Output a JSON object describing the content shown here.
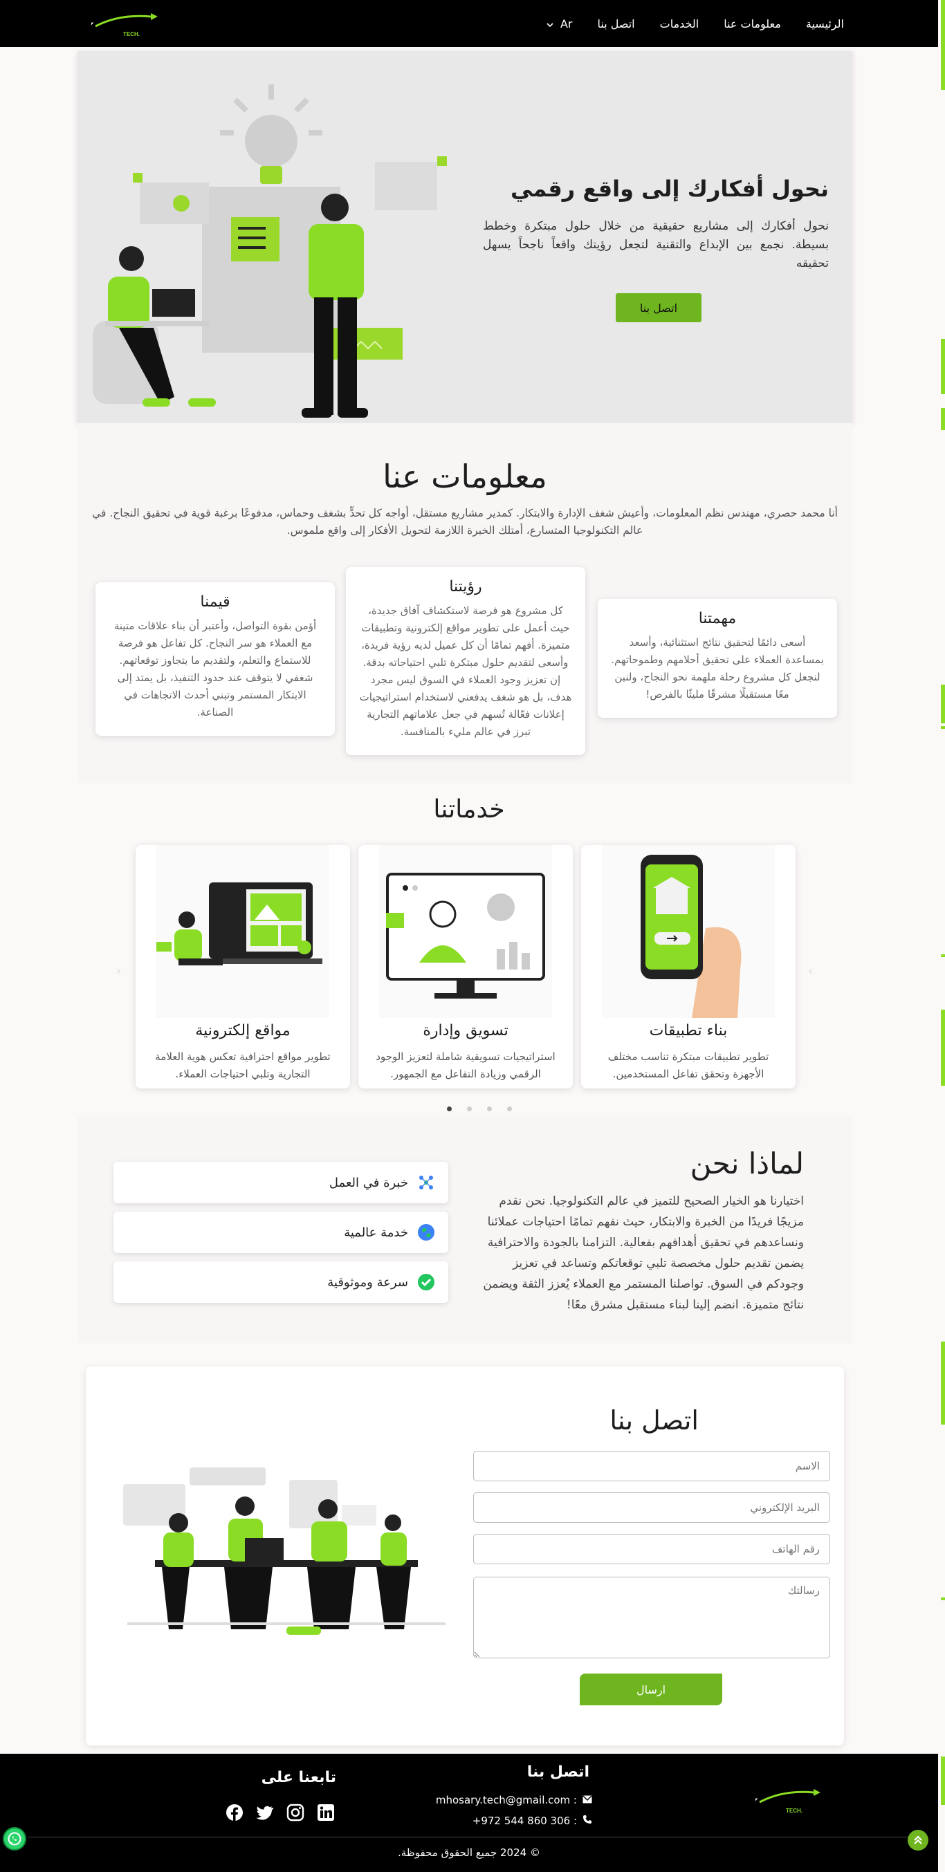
{
  "nav": {
    "links": [
      "الرئيسية",
      "معلومات عنا",
      "الخدمات",
      "اتصل بنا"
    ],
    "lang": "Ar",
    "logo_text": "MHOSARY",
    "logo_sub": ".TECH"
  },
  "hero": {
    "title": "نحول أفكارك إلى واقع رقمي",
    "text": "نحول أفكارك إلى مشاريع حقيقية من خلال حلول مبتكرة وخطط بسيطة. نجمع بين الإبداع والتقنية لتجعل رؤيتك واقعاً ناجحاً يسهل تحقيقه",
    "button": "اتصل بنا"
  },
  "about": {
    "title": "معلومات عنا",
    "text": "أنا محمد حصري، مهندس نظم المعلومات، وأعيش شغف الإدارة والابتكار. كمدير مشاريع مستقل، أواجه كل تحدٍّ بشغف وحماس، مدفوعًا برغبة قوية في تحقيق النجاح. في عالم التكنولوجيا المتسارع، أمتلك الخبرة اللازمة لتحويل الأفكار إلى واقع ملموس.",
    "cards": [
      {
        "title": "مهمتنا",
        "text": "أسعى دائمًا لتحقيق نتائج استثنائية، وأسعد بمساعدة العملاء على تحقيق أحلامهم وطموحاتهم. لنجعل كل مشروع رحلة ملهمة نحو النجاح، ولنبن معًا مستقبلًا مشرقًا مليئًا بالفرص!"
      },
      {
        "title": "رؤيتنا",
        "text": "كل مشروع هو فرصة لاستكشاف آفاق جديدة، حيث أعمل على تطوير مواقع إلكترونية وتطبيقات متميزة. أفهم تمامًا أن كل عميل لديه رؤية فريدة، وأسعى لتقديم حلول مبتكرة تلبي احتياجاته بدقة. إن تعزيز وجود العملاء في السوق ليس مجرد هدف، بل هو شغف يدفعني لاستخدام استراتيجيات إعلانات فعّالة تُسهم في جعل علاماتهم التجارية تبرز في عالم مليء بالمنافسة."
      },
      {
        "title": "قيمنا",
        "text": "أؤمن بقوة التواصل، وأعتبر أن بناء علاقات متينة مع العملاء هو سر النجاح. كل تفاعل هو فرصة للاستماع والتعلم، ولتقديم ما يتجاوز توقعاتهم. شغفي لا يتوقف عند حدود التنفيذ، بل يمتد إلى الابتكار المستمر وتبني أحدث الاتجاهات في الصناعة."
      }
    ]
  },
  "services": {
    "title": "خدماتنا",
    "items": [
      {
        "title": "بناء تطبيقات",
        "text": "تطوير تطبيقات مبتكرة تناسب مختلف الأجهزة وتحقق تفاعل المستخدمين."
      },
      {
        "title": "تسويق وإدارة",
        "text": "استراتيجيات تسويقية شاملة لتعزيز الوجود الرقمي وزيادة التفاعل مع الجمهور."
      },
      {
        "title": "مواقع إلكترونية",
        "text": "تطوير مواقع احترافية تعكس هوية العلامة التجارية وتلبي احتياجات العملاء."
      }
    ]
  },
  "why": {
    "title": "لماذا نحن",
    "text": "اختيارنا هو الخيار الصحيح للتميز في عالم التكنولوجيا. نحن نقدم مزيجًا فريدًا من الخبرة والابتكار، حيث نفهم تمامًا احتياجات عملائنا ونساعدهم في تحقيق أهدافهم بفعالية. التزامنا بالجودة والاحترافية يضمن تقديم حلول مخصصة تلبي توقعاتكم وتساعد في تعزيز وجودكم في السوق. تواصلنا المستمر مع العملاء يُعزز الثقة ويضمن نتائج متميزة. انضم إلينا لبناء مستقبل مشرق معًا!",
    "items": [
      "خبرة في العمل",
      "خدمة عالمية",
      "سرعة وموثوقية"
    ]
  },
  "contact": {
    "title": "اتصل بنا",
    "name_placeholder": "الاسم",
    "email_placeholder": "البريد الإلكتروني",
    "phone_placeholder": "رقم الهاتف",
    "message_placeholder": "رسالتك",
    "send": "ارسال"
  },
  "footer": {
    "contact_title": "اتصل بنا",
    "email": "mhosary.tech@gmail.com :",
    "phone": "+972 544 860 306 :",
    "follow_title": "تابعنا على",
    "copyright": "© 2024 جميع الحقوق محفوظة."
  },
  "colors": {
    "accent": "#6fb51f",
    "bright": "#8bdc24",
    "nav_bg": "#000000"
  }
}
